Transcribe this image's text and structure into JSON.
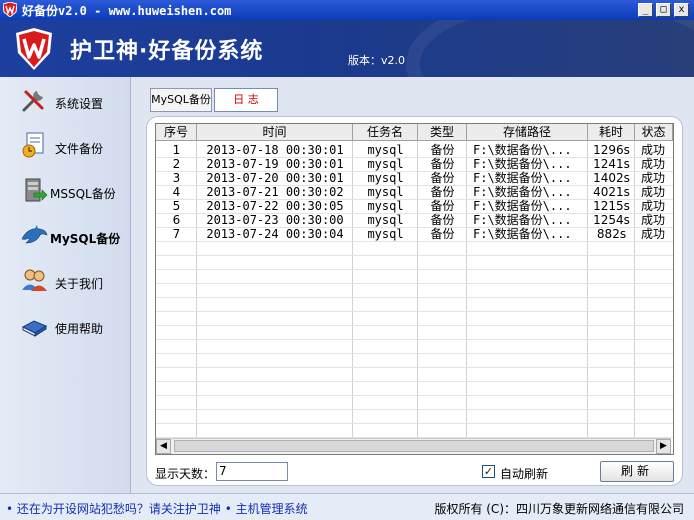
{
  "window": {
    "title": "好备份v2.0 - www.huweishen.com",
    "min": "_",
    "max": "□",
    "close": "x"
  },
  "header": {
    "title": "护卫神·好备份系统",
    "version": "版本：v2.0"
  },
  "sidebar": {
    "items": [
      {
        "label": "系统设置",
        "icon": "tools-icon"
      },
      {
        "label": "文件备份",
        "icon": "document-clock-icon"
      },
      {
        "label": "MSSQL备份",
        "icon": "mssql-icon"
      },
      {
        "label": "MySQL备份",
        "icon": "dolphin-icon",
        "active": true
      },
      {
        "label": "关于我们",
        "icon": "users-icon"
      },
      {
        "label": "使用帮助",
        "icon": "book-icon"
      }
    ]
  },
  "tabs": [
    {
      "label": "MySQL备份"
    },
    {
      "label": "日  志",
      "active": true
    }
  ],
  "table": {
    "columns": [
      "序号",
      "时间",
      "任务名",
      "类型",
      "存储路径",
      "耗时",
      "状态"
    ],
    "rows": [
      [
        "1",
        "2013-07-18 00:30:01",
        "mysql",
        "备份",
        "F:\\数据备份\\...",
        "1296s",
        "成功"
      ],
      [
        "2",
        "2013-07-19 00:30:01",
        "mysql",
        "备份",
        "F:\\数据备份\\...",
        "1241s",
        "成功"
      ],
      [
        "3",
        "2013-07-20 00:30:01",
        "mysql",
        "备份",
        "F:\\数据备份\\...",
        "1402s",
        "成功"
      ],
      [
        "4",
        "2013-07-21 00:30:02",
        "mysql",
        "备份",
        "F:\\数据备份\\...",
        "4021s",
        "成功"
      ],
      [
        "5",
        "2013-07-22 00:30:05",
        "mysql",
        "备份",
        "F:\\数据备份\\...",
        "1215s",
        "成功"
      ],
      [
        "6",
        "2013-07-23 00:30:00",
        "mysql",
        "备份",
        "F:\\数据备份\\...",
        "1254s",
        "成功"
      ],
      [
        "7",
        "2013-07-24 00:30:04",
        "mysql",
        "备份",
        "F:\\数据备份\\...",
        "882s",
        "成功"
      ]
    ]
  },
  "controls": {
    "days_label": "显示天数：",
    "days_value": "7",
    "auto_refresh_label": "自动刷新",
    "auto_refresh_checked": true,
    "check_mark": "✓",
    "refresh_button": "刷新"
  },
  "footer": {
    "left": "• 还在为开设网站犯愁吗？请关注护卫神 • 主机管理系统",
    "right": "版权所有 (C)：四川万象更新网络通信有限公司"
  },
  "colors": {
    "titlebar": "#0b3cb8",
    "header": "#1d3f9e",
    "tab_active_text": "#d00000",
    "link": "#1030b0"
  }
}
